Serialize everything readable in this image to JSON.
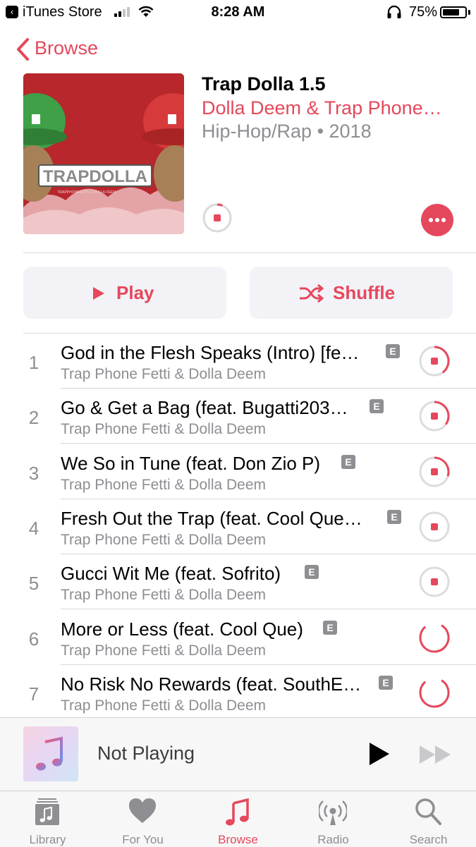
{
  "status_bar": {
    "back_app": "iTunes Store",
    "time": "8:28 AM",
    "battery": "75%",
    "battery_level": 0.75
  },
  "nav": {
    "back_label": "Browse"
  },
  "album": {
    "title": "Trap Dolla 1.5",
    "artist": "Dolla Deem & Trap Phone…",
    "meta": "Hip-Hop/Rap • 2018",
    "artwork_text": "TRAPDOLLA",
    "artwork_subtext": "TRAPPHONEFETTI & DOLLA DEEM"
  },
  "actions": {
    "play_label": "Play",
    "shuffle_label": "Shuffle"
  },
  "tracks": [
    {
      "num": "1",
      "title": "God in the Flesh Speaks (Intro) [fe…",
      "artist": "Trap Phone Fetti & Dolla Deem",
      "explicit": "E",
      "download_progress": 0.4
    },
    {
      "num": "2",
      "title": "Go & Get a Bag (feat. Bugatti203…",
      "artist": "Trap Phone Fetti & Dolla Deem",
      "explicit": "E",
      "download_progress": 0.35
    },
    {
      "num": "3",
      "title": "We So in Tune (feat. Don Zio P)",
      "artist": "Trap Phone Fetti & Dolla Deem",
      "explicit": "E",
      "download_progress": 0.3
    },
    {
      "num": "4",
      "title": "Fresh Out the Trap (feat. Cool Que…",
      "artist": "Trap Phone Fetti & Dolla Deem",
      "explicit": "E",
      "download_progress": 0.0
    },
    {
      "num": "5",
      "title": "Gucci Wit Me (feat. Sofrito)",
      "artist": "Trap Phone Fetti & Dolla Deem",
      "explicit": "E",
      "download_progress": 0.0
    },
    {
      "num": "6",
      "title": "More or Less (feat. Cool Que)",
      "artist": "Trap Phone Fetti & Dolla Deem",
      "explicit": "E",
      "download_progress": null
    },
    {
      "num": "7",
      "title": "No Risk No Rewards (feat. SouthE…",
      "artist": "Trap Phone Fetti & Dolla Deem",
      "explicit": "E",
      "download_progress": null
    }
  ],
  "mini_player": {
    "title": "Not Playing"
  },
  "tabs": [
    {
      "label": "Library",
      "icon": "library-icon"
    },
    {
      "label": "For You",
      "icon": "heart-icon"
    },
    {
      "label": "Browse",
      "icon": "music-note-icon",
      "active": true
    },
    {
      "label": "Radio",
      "icon": "radio-icon"
    },
    {
      "label": "Search",
      "icon": "search-icon"
    }
  ],
  "colors": {
    "accent": "#e5485c",
    "secondary_text": "#8e8e93",
    "button_bg": "#f2f2f7"
  }
}
